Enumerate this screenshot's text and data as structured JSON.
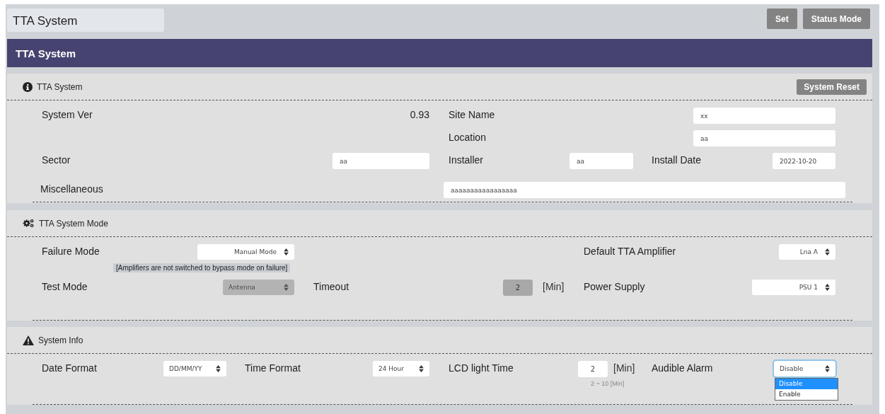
{
  "header": {
    "title": "TTA System",
    "buttons": [
      "Set",
      "Status Mode"
    ]
  },
  "banner": {
    "title": "TTA System"
  },
  "system": {
    "title": "TTA System",
    "button": "System Reset",
    "system_ver": {
      "label": "System Ver",
      "value": "0.93"
    },
    "site_name": {
      "label": "Site Name",
      "value": "xx"
    },
    "location": {
      "label": "Location",
      "value": "aa"
    },
    "sector": {
      "label": "Sector",
      "value": "aa"
    },
    "installer": {
      "label": "Installer",
      "value": "aa"
    },
    "install_date": {
      "label": "Install Date",
      "value": "2022-10-20"
    },
    "miscellaneous": {
      "label": "Miscellaneous",
      "value": "aaaaaaaaaaaaaaaaa"
    }
  },
  "mode": {
    "title": "TTA System Mode",
    "failure_mode": {
      "label": "Failure Mode",
      "value": "Manual Mode",
      "disabled": false,
      "note": "[Amplifiers are not switched to bypass mode on failure]"
    },
    "default_amplifier": {
      "label": "Default TTA Amplifier",
      "value": "Lna A",
      "disabled": false
    },
    "test_mode": {
      "label": "Test Mode",
      "value": "Antenna",
      "disabled": true
    },
    "timeout": {
      "label": "Timeout",
      "value": "2",
      "unit": "[Min]",
      "disabled": true
    },
    "power_supply": {
      "label": "Power Supply",
      "value": "PSU 1",
      "disabled": false
    }
  },
  "info": {
    "title": "System Info",
    "date_format": {
      "label": "Date Format",
      "value": "DD/MM/YY",
      "disabled": false
    },
    "time_format": {
      "label": "Time Format",
      "value": "24 Hour",
      "disabled": false
    },
    "lcd_light_time": {
      "label": "LCD light Time",
      "value": "2",
      "unit": "[Min]",
      "disabled": false,
      "hint": "2 ~ 10 [Min]"
    },
    "audible_alarm": {
      "label": "Audible Alarm",
      "value": "Disable",
      "disabled": false,
      "expanded": true,
      "options": [
        {
          "label": "Disable",
          "selected": true
        },
        {
          "label": "Enable",
          "selected": false
        }
      ]
    }
  }
}
